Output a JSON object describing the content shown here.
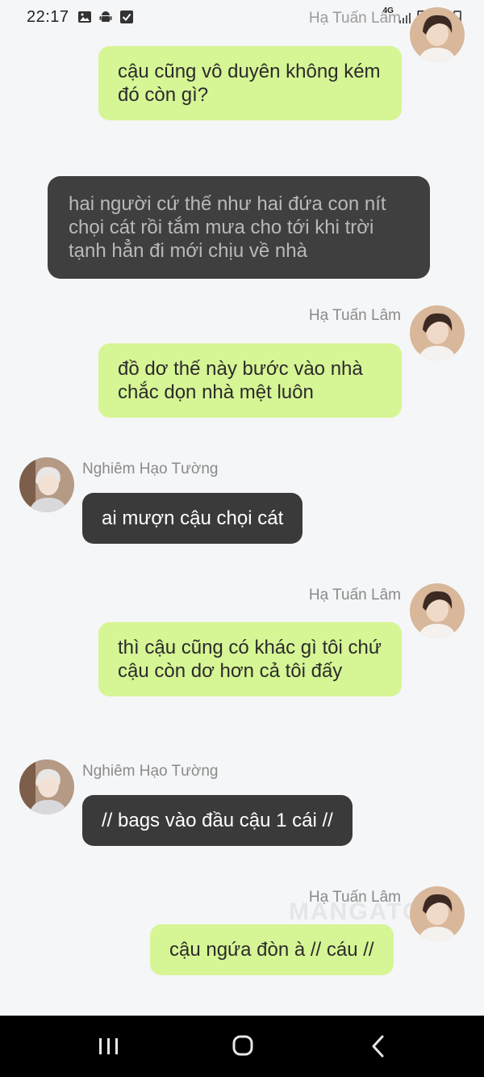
{
  "status": {
    "time": "22:17",
    "network": "4G",
    "battery": "50%"
  },
  "messages": [
    {
      "side": "right",
      "sender": "",
      "text": "cậu cũng vô duyên không kém đó còn gì?"
    },
    {
      "side": "narration",
      "text": "hai người cứ thế như hai đứa con nít chọi cát rồi tắm mưa cho tới khi trời tạnh hẳn đi mới chịu về nhà"
    },
    {
      "side": "right",
      "sender": "Hạ Tuấn Lâm",
      "text": "đồ dơ thế này bước vào nhà chắc dọn nhà mệt luôn"
    },
    {
      "side": "left",
      "sender": "Nghiêm Hạo Tường",
      "text": "ai mượn cậu chọi cát"
    },
    {
      "side": "right",
      "sender": "Hạ Tuấn Lâm",
      "text": "thì cậu cũng có khác gì tôi chứ cậu còn dơ hơn cả tôi đấy"
    },
    {
      "side": "left",
      "sender": "Nghiêm Hạo Tường",
      "text": "// bags vào đầu cậu 1 cái //"
    },
    {
      "side": "right",
      "sender": "Hạ Tuấn Lâm",
      "text": "cậu ngứa đòn à // cáu //"
    }
  ],
  "top_partial_name": "Hạ Tuấn Lâm",
  "watermark": "MANGATO",
  "colors": {
    "my_bubble": "#d6f595",
    "other_bubble": "#3a3a3a",
    "narration_bubble": "#3f3f3f",
    "background": "#f5f6f8"
  },
  "nav": {
    "recent_icon": "recent-apps-icon",
    "home_icon": "home-icon",
    "back_icon": "back-icon"
  }
}
